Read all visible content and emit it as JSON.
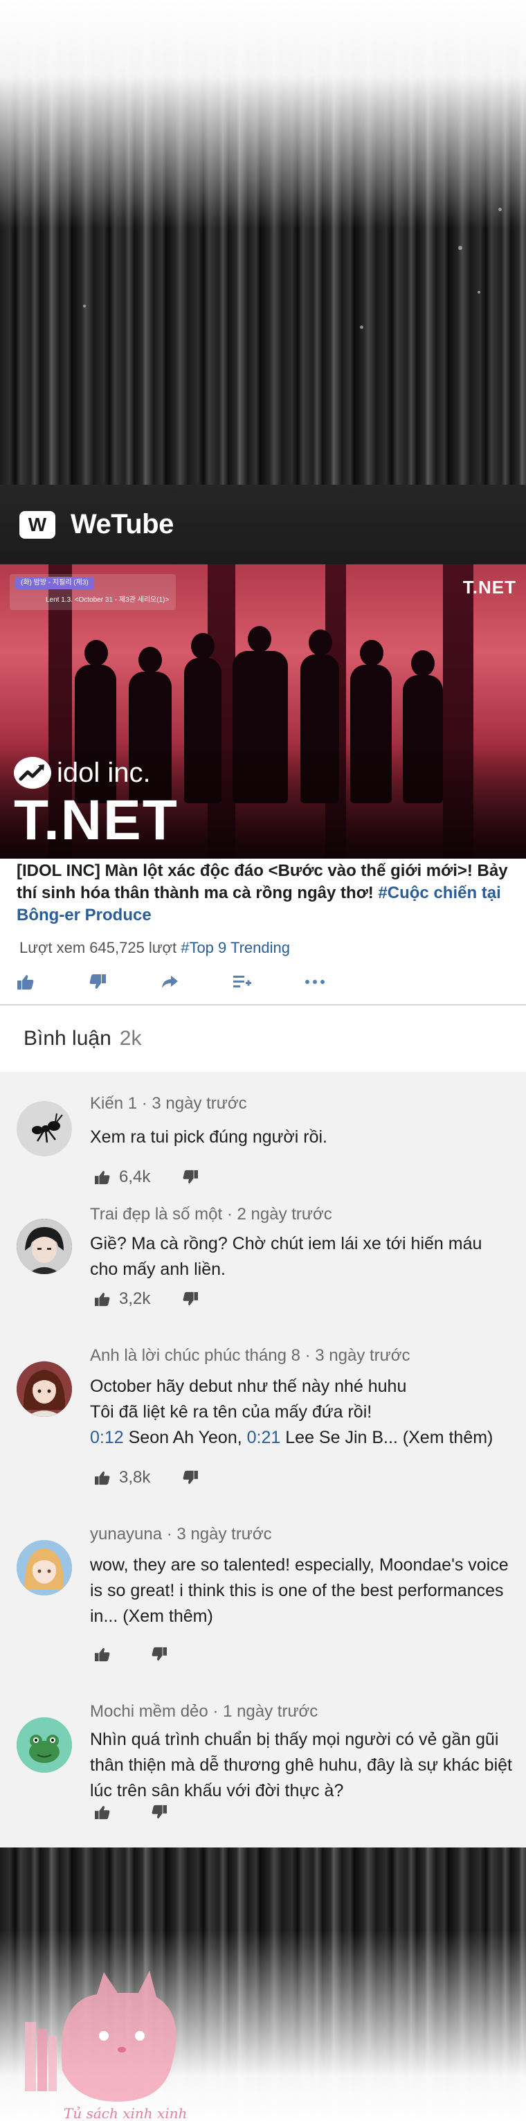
{
  "app": {
    "name": "WeTube",
    "logo_letter": "W"
  },
  "video": {
    "episode_tag": "(화) 밤방 - 지필리 (제3)",
    "episode_caption": "Lent 1.3. <October 31 - 제3관 세리오(1)>",
    "channel_mark": "T.NET",
    "brand_line": "idol inc.",
    "brand_big": "T.NET"
  },
  "title": {
    "text": "[IDOL INC] Màn lột xác độc đáo <Bước vào thế giới mới>! Bảy thí sinh hóa thân thành ma cà rồng ngây thơ! ",
    "hashtag": "#Cuộc chiến tại Bông-er Produce"
  },
  "views": {
    "text": "Lượt xem 645,725 lượt ",
    "trending": "#Top 9 Trending"
  },
  "actions": [
    "like-icon",
    "dislike-icon",
    "share-icon",
    "add-to-playlist-icon",
    "more-icon"
  ],
  "comments_header": {
    "label": "Bình luận",
    "count": "2k"
  },
  "comments": [
    {
      "author": "Kiến 1",
      "time": "3 ngày trước",
      "text": "Xem ra tui pick đúng người rồi.",
      "likes": "6,4k"
    },
    {
      "author": "Trai đẹp là số một",
      "time": "2 ngày trước",
      "text": "Giề? Ma cà rồng? Chờ chút iem lái xe tới hiến máu cho mấy anh liền.",
      "likes": "3,2k"
    },
    {
      "author": "Anh là lời chúc phúc tháng 8",
      "time": "3 ngày trước",
      "line1": "October hãy debut như thế này nhé huhu",
      "line2": "Tôi đã liệt kê ra tên của mấy đứa rồi!",
      "ts1": "0:12",
      "name1": " Seon Ah Yeon, ",
      "ts2": "0:21",
      "name2": " Lee Se Jin B... (Xem thêm)",
      "likes": "3,8k"
    },
    {
      "author": "yunayuna",
      "time": "3 ngày trước",
      "text": "wow, they are so talented! especially, Moondae's voice is so great! i think this is one of the best performances in... (Xem thêm)",
      "likes": ""
    },
    {
      "author": "Mochi mềm dẻo",
      "time": "1 ngày trước",
      "text": "Nhìn quá trình chuẩn bị thấy mọi người có vẻ gần gũi thân thiện mà dễ thương ghê huhu, đây là sự khác biệt lúc trên sân khấu với đời thực à?",
      "likes": ""
    }
  ],
  "watermark": {
    "text": "Tủ sách xinh xinh"
  },
  "colors": {
    "link": "#2a5d9a",
    "appbar": "#1f1f1f",
    "comments_bg": "#f2f2f2",
    "watermark": "#e57f9b"
  }
}
